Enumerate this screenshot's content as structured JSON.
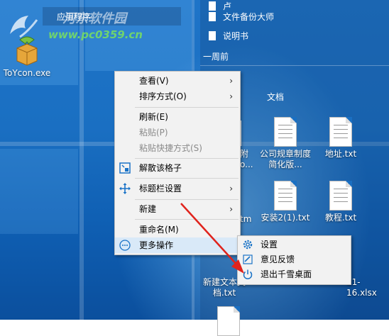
{
  "desktop": {
    "toycon_label": "ToYcon.exe",
    "fence_left_title": "应用程序",
    "fence_week_title": "一周前",
    "fence_docs_title": "文档",
    "top_items": [
      {
        "label": "文件备份大师"
      },
      {
        "label": "说明书"
      }
    ],
    "docs": [
      {
        "label": "公司规章制度简化版..."
      },
      {
        "label": "地址.txt"
      },
      {
        "label": "安装2(1).txt"
      },
      {
        "label": "教程.txt"
      },
      {
        "label": "新建文本文档.txt"
      },
      {
        "label": "01-16.xlsx"
      }
    ],
    "partial_texts": {
      "a": "附",
      "b": "o...",
      "c": "tm",
      "d": "9-"
    },
    "watermark_site": "www.pc0359.cn",
    "watermark_name": "河东软件园"
  },
  "context_menu": {
    "items": [
      {
        "label": "查看(V)",
        "submenu": true
      },
      {
        "label": "排序方式(O)",
        "submenu": true
      },
      {
        "label": "刷新(E)"
      },
      {
        "label": "粘贴(P)",
        "disabled": true
      },
      {
        "label": "粘贴快捷方式(S)",
        "disabled": true
      },
      {
        "label": "解散该格子",
        "icon": "dissolve-icon"
      },
      {
        "label": "标题栏设置",
        "icon": "move-icon",
        "submenu": true
      },
      {
        "label": "新建",
        "submenu": true
      },
      {
        "label": "重命名(M)"
      },
      {
        "label": "更多操作",
        "icon": "more-icon",
        "highlighted": true
      }
    ],
    "arrow_glyph": "›"
  },
  "more_submenu": {
    "items": [
      {
        "label": "设置",
        "icon": "gear-icon"
      },
      {
        "label": "意见反馈",
        "icon": "feedback-icon"
      },
      {
        "label": "退出千雪桌面",
        "icon": "power-icon"
      }
    ]
  },
  "colors": {
    "menu_highlight": "#d9e9f8",
    "accent_blue": "#1a73c7",
    "annotation_red": "#e0231c"
  }
}
